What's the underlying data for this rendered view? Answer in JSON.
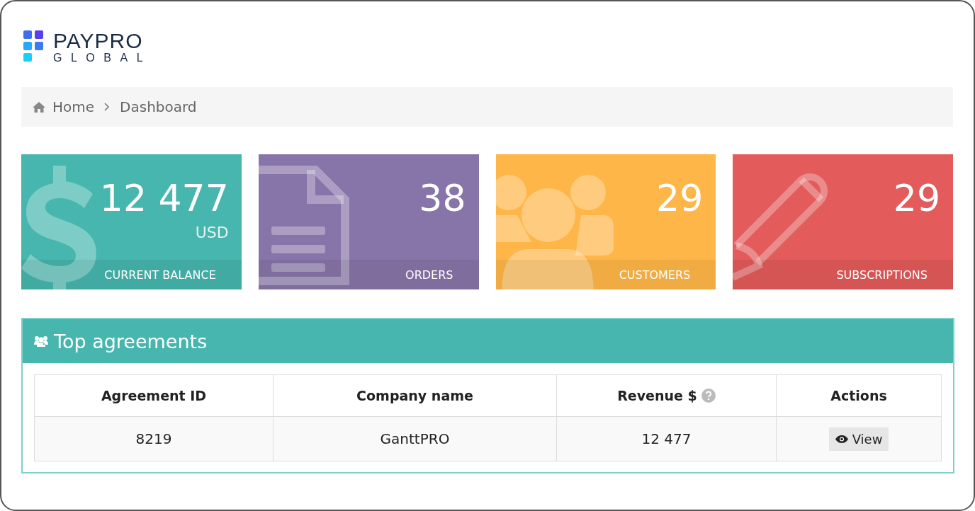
{
  "logo": {
    "name": "PAYPRO",
    "subtitle": "GLOBAL"
  },
  "breadcrumb": [
    {
      "label": "Home",
      "kind": "home"
    },
    {
      "label": "Dashboard",
      "kind": "current"
    }
  ],
  "stat_cards": [
    {
      "kind": "dollar",
      "color": "#46b6ae",
      "value": "12 477",
      "unit": "USD",
      "label": "CURRENT BALANCE"
    },
    {
      "kind": "document",
      "color": "#8774a8",
      "value": "38",
      "label": "ORDERS"
    },
    {
      "kind": "people",
      "color": "#ffb648",
      "value": "29",
      "label": "CUSTOMERS"
    },
    {
      "kind": "pencil",
      "color": "#e35b5b",
      "value": "29",
      "label": "SUBSCRIPTIONS"
    }
  ],
  "panel": {
    "title": "Top agreements",
    "table": {
      "columns": [
        {
          "label": "Agreement ID"
        },
        {
          "label": "Company name"
        },
        {
          "label": "Revenue $",
          "help": true
        },
        {
          "label": "Actions"
        }
      ],
      "rows": [
        {
          "agreement_id": "8219",
          "company": "GanttPRO",
          "revenue": "12 477",
          "action": "View"
        }
      ]
    }
  }
}
